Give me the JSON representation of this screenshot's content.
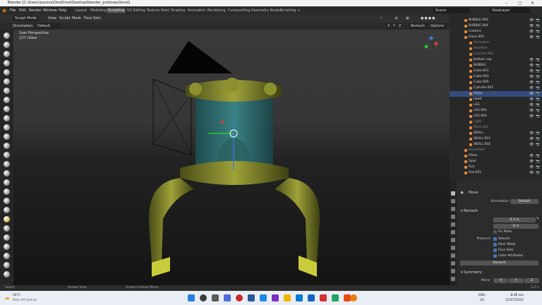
{
  "window": {
    "title": "Blender [C:\\Users\\Lenovo\\OneDrive\\Desktop\\blender_proj\\new.blend]",
    "controls": [
      "–",
      "▢",
      "✕"
    ]
  },
  "menu": [
    "File",
    "Edit",
    "Render",
    "Window",
    "Help"
  ],
  "workspaces": [
    "Layout",
    "Modeling",
    "Sculpting",
    "UV Editing",
    "Texture Paint",
    "Shading",
    "Animation",
    "Rendering",
    "Compositing",
    "Geometry Nodes",
    "Scripting",
    "+"
  ],
  "active_workspace": "Sculpting",
  "scene": {
    "scene_label": "Scene",
    "view_layer_label": "ViewLayer"
  },
  "header": {
    "mode": "Sculpt Mode",
    "view": "View",
    "sculpt": "Sculpt",
    "mask": "Mask",
    "face_sets": "Face Sets"
  },
  "header2": {
    "orientation_label": "Orientation:",
    "orientation_value": "Default",
    "x": "X",
    "y": "Y",
    "z": "Z",
    "remesh": "Remesh",
    "options": "Options"
  },
  "viewport": {
    "view_name": "User Perspective",
    "object_info": "(27) Glass"
  },
  "outliner": [
    {
      "name": "BUBBLE.003",
      "indent": 1,
      "vis": true
    },
    {
      "name": "BUBBLE.004",
      "indent": 1,
      "vis": true
    },
    {
      "name": "Camera",
      "indent": 1,
      "vis": true
    },
    {
      "name": "Glass.001",
      "indent": 1,
      "vis": true
    },
    {
      "name": "Animation",
      "indent": 2,
      "vis": false
    },
    {
      "name": "Modifiers",
      "indent": 2,
      "vis": false
    },
    {
      "name": "Cylinder.004",
      "indent": 2,
      "vis": false
    },
    {
      "name": "bottom cap",
      "indent": 2,
      "vis": true
    },
    {
      "name": "BUBBLE",
      "indent": 2,
      "vis": true
    },
    {
      "name": "Cube.001",
      "indent": 2,
      "vis": true
    },
    {
      "name": "Cube.003",
      "indent": 2,
      "vis": true
    },
    {
      "name": "Cube.005",
      "indent": 2,
      "vis": true
    },
    {
      "name": "Cylinder.001",
      "indent": 2,
      "vis": true
    },
    {
      "name": "Glass",
      "indent": 2,
      "vis": true,
      "selected": true
    },
    {
      "name": "head",
      "indent": 2,
      "vis": true
    },
    {
      "name": "LEG",
      "indent": 2,
      "vis": true
    },
    {
      "name": "LEG.001",
      "indent": 2,
      "vis": true
    },
    {
      "name": "LEG.002",
      "indent": 2,
      "vis": true
    },
    {
      "name": "Light",
      "indent": 2,
      "vis": false
    },
    {
      "name": "Point.001",
      "indent": 2,
      "vis": false
    },
    {
      "name": "SKULL",
      "indent": 2,
      "vis": true
    },
    {
      "name": "SKULL.001",
      "indent": 2,
      "vis": true
    },
    {
      "name": "SKULL.002",
      "indent": 2,
      "vis": true
    },
    {
      "name": "NurbsPath",
      "indent": 1,
      "vis": false
    },
    {
      "name": "Plane",
      "indent": 1,
      "vis": true
    },
    {
      "name": "Spot",
      "indent": 1,
      "vis": true
    },
    {
      "name": "Sun",
      "indent": 1,
      "vis": true
    },
    {
      "name": "Suz.001",
      "indent": 1,
      "vis": true
    }
  ],
  "props": {
    "tool": "Move",
    "orientation_label": "Orientation",
    "orientation_value": "Default",
    "remesh_section": "Remesh",
    "voxel_size_label": "Voxel Size",
    "voxel_size": "0.1 m",
    "adaptivity_label": "Adaptivity",
    "adaptivity": "0 m",
    "fix_poles": "Fix Poles",
    "preserve_label": "Preserve",
    "volume": "Volume",
    "paint_mask": "Paint Mask",
    "face_sets": "Face Sets",
    "color_attributes": "Color Attributes",
    "remesh_button": "Remesh",
    "symmetry_section": "Symmetry",
    "mirror_label": "Mirror",
    "mx": "X",
    "my": "Y",
    "mz": "Z"
  },
  "statusbar": {
    "select": "Select",
    "rotate": "Rotate View",
    "context": "Sculpt Context Menu",
    "version": "3.2.1"
  },
  "taskbar": {
    "temp": "26°C",
    "weather": "Rain off and on",
    "lang": "ENG",
    "region": "US",
    "time": "8:46 am",
    "date": "21/07/2022"
  }
}
